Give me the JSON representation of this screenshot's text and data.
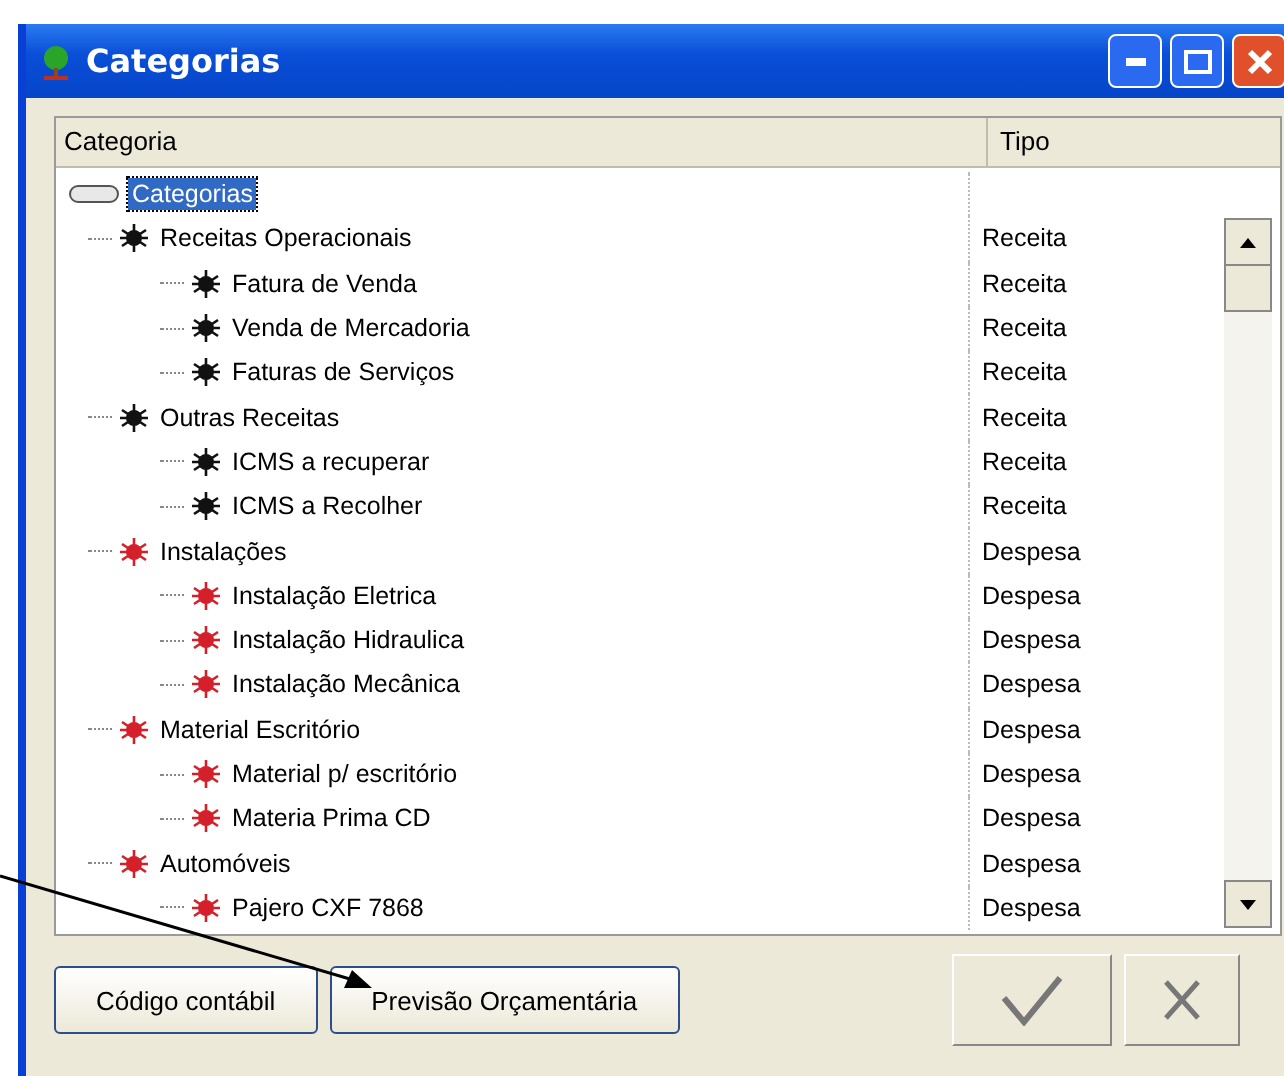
{
  "window": {
    "title": "Categorias"
  },
  "table": {
    "columns": [
      "Categoria",
      "Tipo"
    ],
    "tree": [
      {
        "label": "Categorias",
        "selected": true,
        "expanded": true,
        "children": [
          {
            "label": "Receitas Operacionais",
            "tipo": "Receita",
            "kind": "receita",
            "selected": false,
            "children": [
              {
                "label": "Fatura de Venda",
                "tipo": "Receita",
                "kind": "receita",
                "selected": false
              },
              {
                "label": "Venda de Mercadoria",
                "tipo": "Receita",
                "kind": "receita",
                "selected": false
              },
              {
                "label": "Faturas de Serviços",
                "tipo": "Receita",
                "kind": "receita",
                "selected": false
              }
            ]
          },
          {
            "label": "Outras Receitas",
            "tipo": "Receita",
            "kind": "receita",
            "selected": false,
            "children": [
              {
                "label": "ICMS a recuperar",
                "tipo": "Receita",
                "kind": "receita",
                "selected": false
              },
              {
                "label": "ICMS a Recolher",
                "tipo": "Receita",
                "kind": "receita",
                "selected": false
              }
            ]
          },
          {
            "label": "Instalações",
            "tipo": "Despesa",
            "kind": "despesa",
            "selected": false,
            "children": [
              {
                "label": "Instalação Eletrica",
                "tipo": "Despesa",
                "kind": "despesa",
                "selected": false
              },
              {
                "label": "Instalação Hidraulica",
                "tipo": "Despesa",
                "kind": "despesa",
                "selected": false
              },
              {
                "label": "Instalação Mecânica",
                "tipo": "Despesa",
                "kind": "despesa",
                "selected": false
              }
            ]
          },
          {
            "label": "Material Escritório",
            "tipo": "Despesa",
            "kind": "despesa",
            "selected": false,
            "children": [
              {
                "label": "Material p/ escritório",
                "tipo": "Despesa",
                "kind": "despesa",
                "selected": false
              },
              {
                "label": "Materia Prima CD",
                "tipo": "Despesa",
                "kind": "despesa",
                "selected": false
              }
            ]
          },
          {
            "label": "Automóveis",
            "tipo": "Despesa",
            "kind": "despesa",
            "selected": false,
            "children": [
              {
                "label": "Pajero CXF 7868",
                "tipo": "Despesa",
                "kind": "despesa",
                "selected": false
              }
            ]
          }
        ]
      }
    ]
  },
  "buttons": [
    {
      "label": "Código contábil",
      "kind": "text"
    },
    {
      "label": "Previsão Orçamentária",
      "kind": "text"
    },
    {
      "kind": "confirm"
    },
    {
      "kind": "cancel"
    }
  ]
}
